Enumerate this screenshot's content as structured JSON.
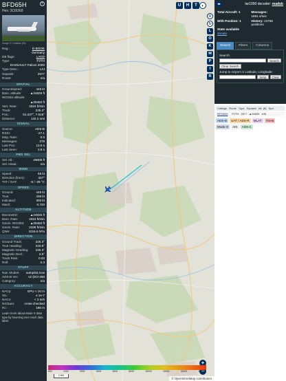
{
  "aircraft": {
    "callsign": "BFD65H",
    "hex_line": "Hex: 3C6DE8",
    "photo_credit": "Image © Christian (Ry"
  },
  "info_rows": [
    {
      "k": "Reg.:",
      "v": "D-BOOK",
      "link": true
    },
    {
      "k": "",
      "v": "Germany"
    },
    {
      "k": "DB flags:",
      "v": "LADD",
      "link": true
    },
    {
      "k": "Type:",
      "v": "F2TH"
    },
    {
      "k": "",
      "v": "DASSAULT Falcon 2000"
    },
    {
      "k": "Type Desc.:",
      "v": "L2J"
    },
    {
      "k": "Squawk:",
      "v": "2577"
    },
    {
      "k": "Route:",
      "v": "n/a"
    }
  ],
  "sections": [
    {
      "title": "SPATIAL",
      "rows": [
        {
          "k": "Groundspeed:",
          "v": "445 kt"
        },
        {
          "k": "Baro. altitude:",
          "v": "▲24825 ft"
        },
        {
          "k": "WGS84 altitude:",
          "v": ""
        },
        {
          "k": "",
          "v": "▲25450 ft"
        },
        {
          "k": "Vert. Rate:",
          "v": "2624 ft/min"
        },
        {
          "k": "Track:",
          "v": "225.3°"
        },
        {
          "k": "Pos.:",
          "v": "51.237°, 7.618°"
        },
        {
          "k": "Distance:",
          "v": "132.2 nmi"
        }
      ]
    },
    {
      "title": "SIGNAL",
      "rows": [
        {
          "k": "Source:",
          "v": "ADS-B"
        },
        {
          "k": "RSSI:",
          "v": "-27.1"
        },
        {
          "k": "Msg. Rate:",
          "v": "0.0"
        },
        {
          "k": "Messages:",
          "v": "276"
        },
        {
          "k": "Last Pos.:",
          "v": "13.5 s"
        },
        {
          "k": "Last Seen:",
          "v": "3.8 s"
        }
      ]
    },
    {
      "title": "FMS SEL",
      "rows": [
        {
          "k": "Sel. Alt.:",
          "v": "29008 ft"
        },
        {
          "k": "Sel. Head.:",
          "v": "n/a"
        }
      ]
    },
    {
      "title": "WIND",
      "rows": [
        {
          "k": "Speed:",
          "v": "65 kt"
        },
        {
          "k": "Direction (from):",
          "v": "327°"
        },
        {
          "k": "TAT / OAT:",
          "v": "-5 / -29 °C"
        }
      ]
    },
    {
      "title": "SPEED",
      "rows": [
        {
          "k": "Ground:",
          "v": "445 kt"
        },
        {
          "k": "True:",
          "v": "436 kt"
        },
        {
          "k": "Indicated:",
          "v": "300 kt"
        },
        {
          "k": "Mach:",
          "v": "0.720"
        }
      ]
    },
    {
      "title": "ALTITUDE",
      "rows": [
        {
          "k": "Barometric:",
          "v": "▲24825 ft"
        },
        {
          "k": "Baro. Rate:",
          "v": "2624 ft/min"
        },
        {
          "k": "Geom. WGS84:",
          "v": "▲25450 ft"
        },
        {
          "k": "Geom. Rate:",
          "v": "2336 ft/min"
        },
        {
          "k": "QNH:",
          "v": "1015.6 hPa"
        }
      ]
    },
    {
      "title": "DIRECTION",
      "rows": [
        {
          "k": "Ground Track:",
          "v": "225.3°"
        },
        {
          "k": "True Heading:",
          "v": "233.6°"
        },
        {
          "k": "Magnetic Heading:",
          "v": "230.3°"
        },
        {
          "k": "Magnetic Decl.:",
          "v": "3.5°"
        },
        {
          "k": "Track Rate:",
          "v": "0.03"
        },
        {
          "k": "Roll:",
          "v": "0.3"
        }
      ]
    },
    {
      "title": "STUFF",
      "rows": [
        {
          "k": "Nav. Modes:",
          "v": "autopilot,tcas"
        },
        {
          "k": "ADS-B Ver.:",
          "v": "v2 (DO-260"
        },
        {
          "k": "Category:",
          "v": "n/a"
        }
      ]
    },
    {
      "title": "ACCURACY",
      "rows": [
        {
          "k": "NACp:",
          "v": "EPU < 10 m"
        },
        {
          "k": "SIL:",
          "v": "≤ 1e-7"
        },
        {
          "k": "NACv:",
          "v": "< 3 m/s"
        },
        {
          "k": "NICbaro:",
          "v": "cross-checked"
        },
        {
          "k": "Rc:",
          "v": "186 m"
        }
      ]
    }
  ],
  "footnote": "Learn more about Mode S data type by hovering over each data label.",
  "map": {
    "top_buttons": [
      "U",
      "H",
      "T"
    ],
    "side_buttons": [
      "L",
      "O",
      "K",
      "M",
      "P",
      "I",
      "R"
    ],
    "zoom_in": "+",
    "zoom_out": "−",
    "scale": "2 NM",
    "attribution": "© OpenStreetMap contributors.",
    "legend_labels": [
      "800",
      "1000",
      "2000",
      "4000",
      "6000",
      "8000",
      "10000",
      "20000",
      "30000",
      "40000+"
    ]
  },
  "right": {
    "brand_prefix": "tar1090 decoder:",
    "brand_name": "readsb",
    "stats": [
      {
        "k": "Total Aircraft:",
        "v": "1"
      },
      {
        "k": "Messages:",
        "v": "1661.4/sec"
      },
      {
        "k": "With Position:",
        "v": "1"
      },
      {
        "k": "History:",
        "v": "23786 positions"
      },
      {
        "k": "Stats available",
        "v": ""
      }
    ],
    "donate": "donate",
    "tabs": [
      "Search",
      "Filters",
      "Columns"
    ],
    "search_label": "Search:",
    "search_button": "Search",
    "clear_button": "Clear Search",
    "jump_label": "Jump to Airport or Latitude, Longitude:",
    "jump_button": "Jump",
    "clear2_button": "Clear",
    "table_headers": [
      "Callsign",
      "Route",
      "Type",
      "Squawk",
      "Alt. (ft)",
      "Spd"
    ],
    "table_row": [
      "BFD65H",
      "",
      "F2TH",
      "2577",
      "▲24825",
      "445"
    ],
    "chips": [
      {
        "label": "ADS-B",
        "color": "#c3dbf5"
      },
      {
        "label": "UAT / ADS-R",
        "color": "#ffd8a8"
      },
      {
        "label": "MLAT",
        "color": "#e8d1f0"
      },
      {
        "label": "TIS-B",
        "color": "#f8c0c0"
      },
      {
        "label": "Mode-S",
        "color": "#d0d8e8"
      },
      {
        "label": "AIS",
        "color": "#f0f0f0"
      },
      {
        "label": "ADS-C",
        "color": "#c9ecd2"
      }
    ]
  }
}
